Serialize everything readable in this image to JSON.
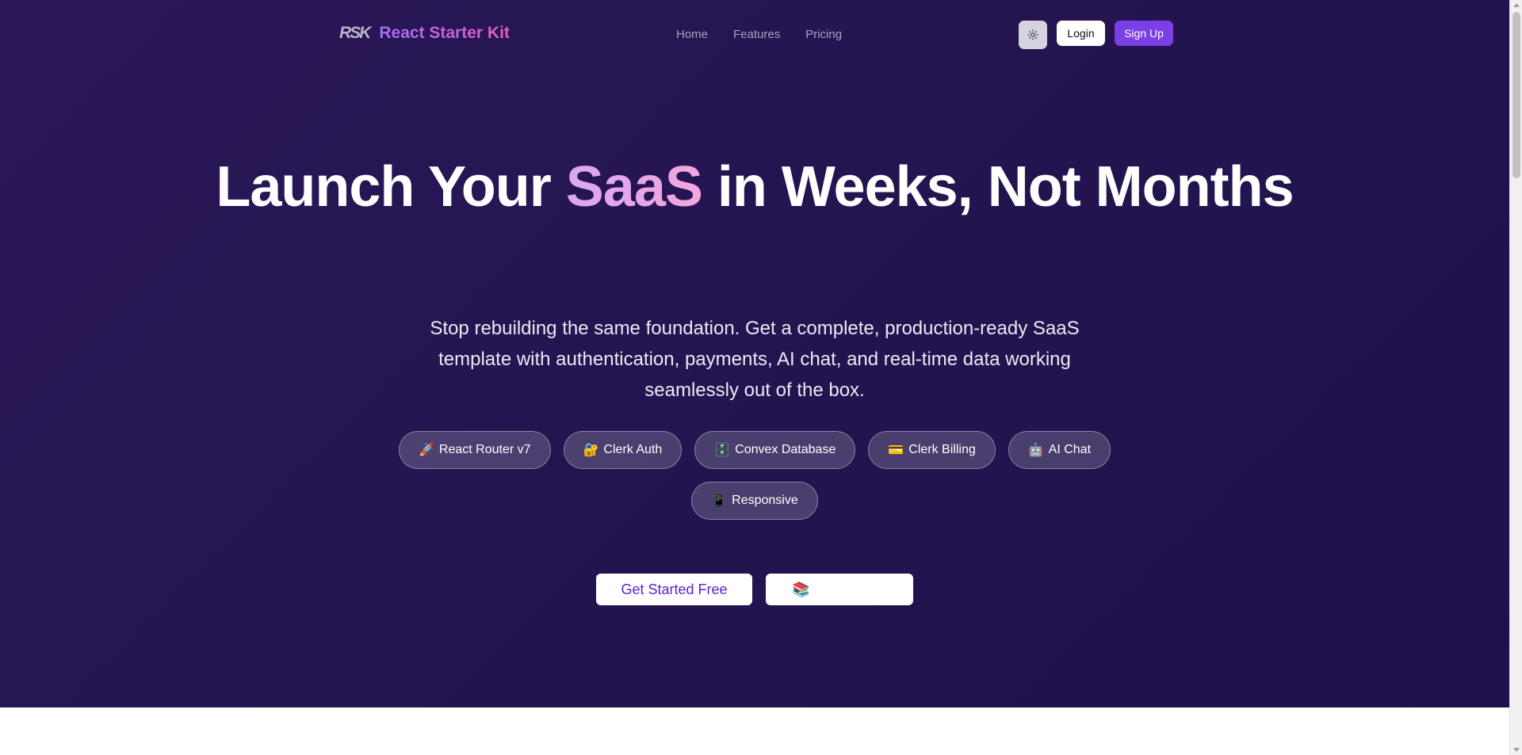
{
  "nav": {
    "logo_mark": "RSK",
    "logo_text": "React Starter Kit",
    "links": [
      {
        "label": "Home"
      },
      {
        "label": "Features"
      },
      {
        "label": "Pricing"
      }
    ],
    "theme_toggle_icon": "sun-icon",
    "login_label": "Login",
    "signup_label": "Sign Up"
  },
  "hero": {
    "headline_prefix": "Launch Your ",
    "headline_highlight": "SaaS",
    "headline_suffix": " in Weeks, Not Months",
    "subtext": "Stop rebuilding the same foundation. Get a complete, production-ready SaaS template with authentication, payments, AI chat, and real-time data working seamlessly out of the box.",
    "pills": [
      {
        "emoji": "🚀",
        "label": "React Router v7"
      },
      {
        "emoji": "🔐",
        "label": "Clerk Auth"
      },
      {
        "emoji": "🗄️",
        "label": "Convex Database"
      },
      {
        "emoji": "💳",
        "label": "Clerk Billing"
      },
      {
        "emoji": "🤖",
        "label": "AI Chat"
      },
      {
        "emoji": "📱",
        "label": "Responsive"
      }
    ],
    "cta_primary": "Get Started Free",
    "cta_secondary_emoji": "📚"
  },
  "colors": {
    "accent": "#7b3fe6",
    "hero_bg": "#251552",
    "highlight": "#e2a5ee"
  }
}
